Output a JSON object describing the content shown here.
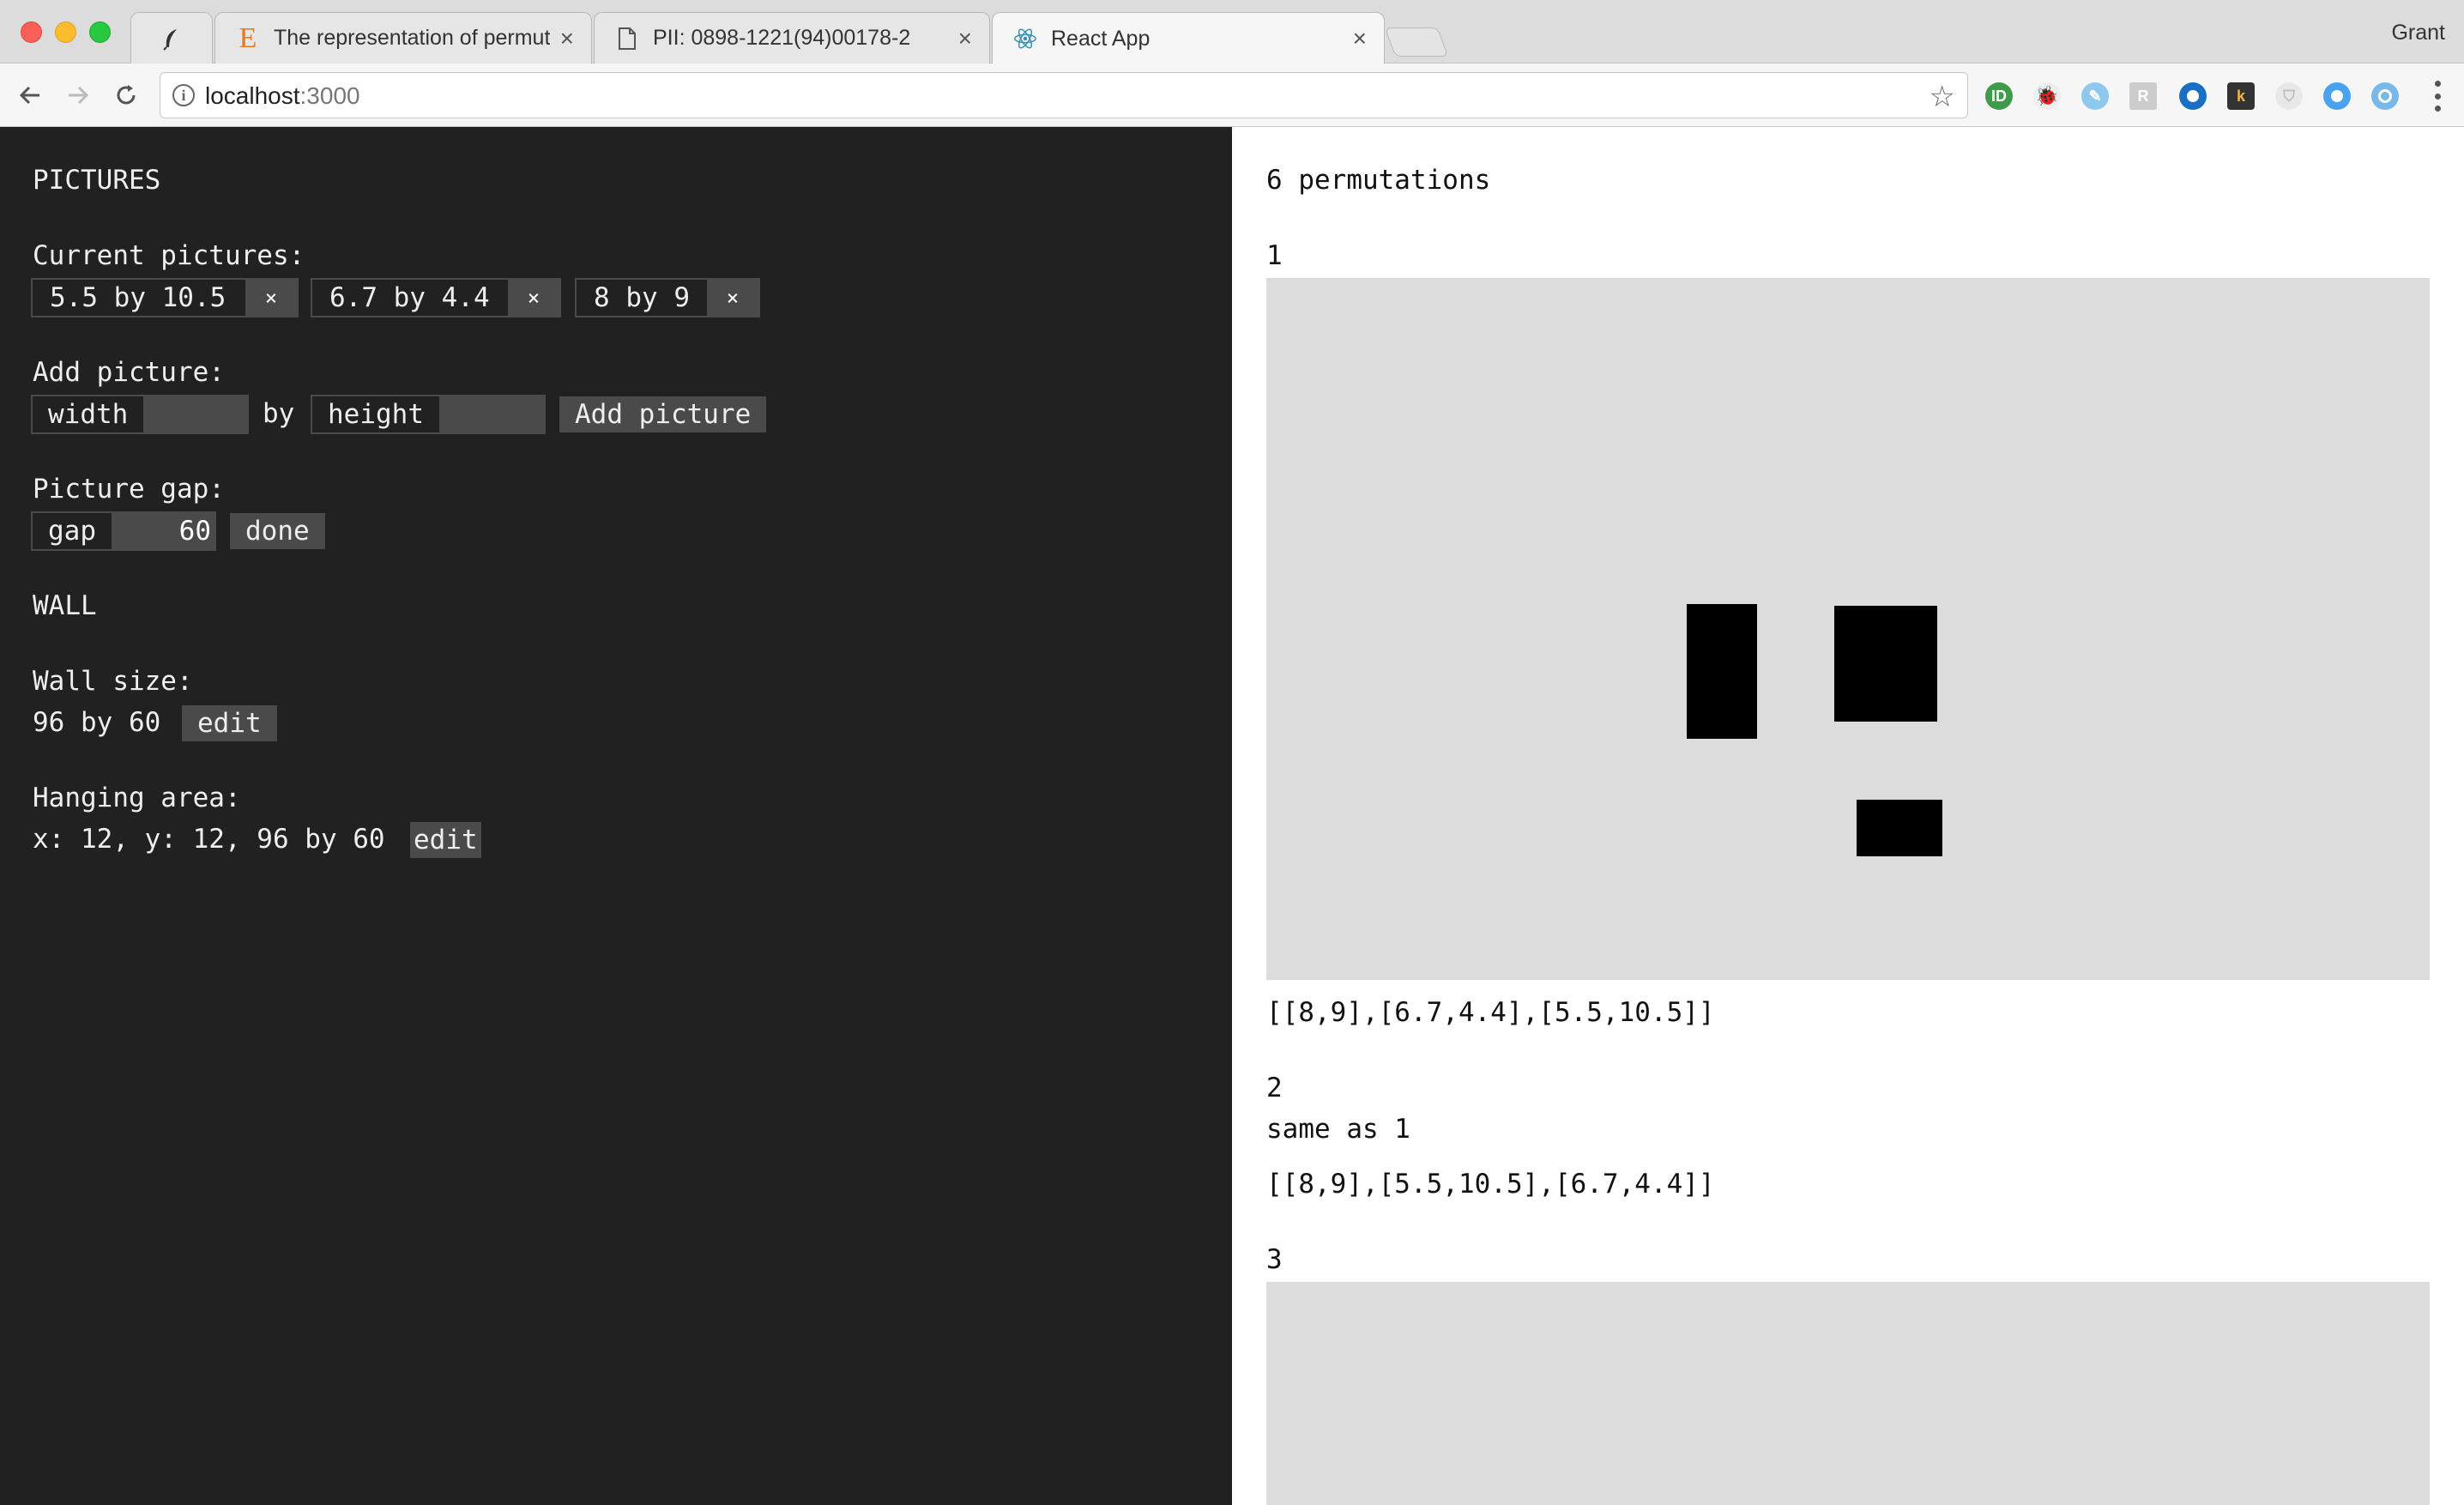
{
  "browser": {
    "tabs": [
      {
        "title": "",
        "favicon": "feather-icon"
      },
      {
        "title": "The representation of permuta",
        "favicon": "elsevier-icon"
      },
      {
        "title": "PII: 0898-1221(94)00178-2",
        "favicon": "document-icon"
      },
      {
        "title": "React App",
        "favicon": "react-icon"
      }
    ],
    "profile": "Grant",
    "url_host": "localhost",
    "url_port": ":3000"
  },
  "app": {
    "pictures_heading": "PICTURES",
    "current_label": "Current pictures:",
    "pictures": [
      {
        "label": "5.5 by 10.5",
        "remove": "×"
      },
      {
        "label": "6.7 by 4.4",
        "remove": "×"
      },
      {
        "label": "8 by 9",
        "remove": "×"
      }
    ],
    "add_label": "Add picture:",
    "width_label": "width",
    "by_label": "by",
    "height_label": "height",
    "add_button": "Add picture",
    "gap_heading": "Picture gap:",
    "gap_label": "gap",
    "gap_value": "60",
    "done_button": "done",
    "wall_heading": "WALL",
    "wall_size_label": "Wall size:",
    "wall_size_value": "96 by 60",
    "wall_edit": "edit",
    "hanging_label": "Hanging area:",
    "hanging_value": "x: 12, y: 12, 96 by 60",
    "hanging_edit": "edit"
  },
  "results": {
    "count_text": "6 permutations",
    "items": [
      {
        "index": "1",
        "order": "[[8,9],[6.7,4.4],[5.5,10.5]]"
      },
      {
        "index": "2",
        "note": "same as 1",
        "order": "[[8,9],[5.5,10.5],[6.7,4.4]]"
      },
      {
        "index": "3"
      }
    ]
  },
  "colors": {
    "left_bg": "#212121",
    "control_bg": "#4a4a4a",
    "wall_bg": "#dcdcdc",
    "picture_fill": "#000000"
  }
}
